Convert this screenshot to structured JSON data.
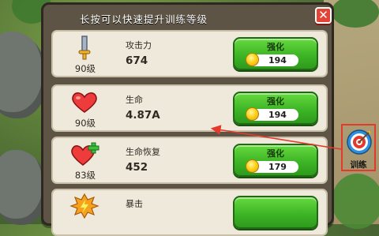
{
  "title": "长按可以快速提升训练等级",
  "close_icon": "close-icon",
  "upgrade_label": "强化",
  "rows": [
    {
      "icon": "sword-icon",
      "level": "90级",
      "name": "攻击力",
      "value": "674",
      "cost": "194"
    },
    {
      "icon": "heart-icon",
      "level": "90级",
      "name": "生命",
      "value": "4.87A",
      "cost": "194"
    },
    {
      "icon": "heart-plus-icon",
      "level": "83级",
      "name": "生命恢复",
      "value": "452",
      "cost": "179"
    },
    {
      "icon": "burst-icon",
      "level": "",
      "name": "暴击",
      "value": "",
      "cost": ""
    }
  ],
  "training": {
    "label": "训练",
    "icon": "target-icon"
  },
  "colors": {
    "accent_red": "#e33a2b",
    "upgrade_green": "#3db526"
  }
}
